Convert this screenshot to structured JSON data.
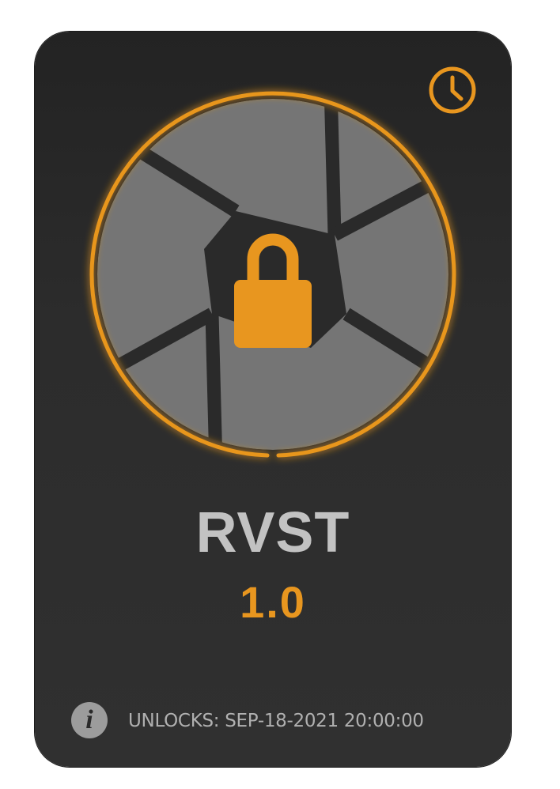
{
  "token": {
    "name": "RVST",
    "version": "1.0"
  },
  "footer": {
    "unlocks_text": "UNLOCKS: SEP-18-2021 20:00:00",
    "info_icon": "info-icon",
    "info_glyph": "i"
  },
  "icons": {
    "clock": "clock-icon",
    "lock": "lock-icon",
    "aperture": "camera-aperture-icon"
  },
  "colors": {
    "accent": "#e8961f",
    "card_background": "#2a2a2a",
    "aperture_blades": "#757575",
    "title_text": "#c2c2c2",
    "footer_text": "#b0b0b0"
  },
  "state": {
    "locked": true
  }
}
